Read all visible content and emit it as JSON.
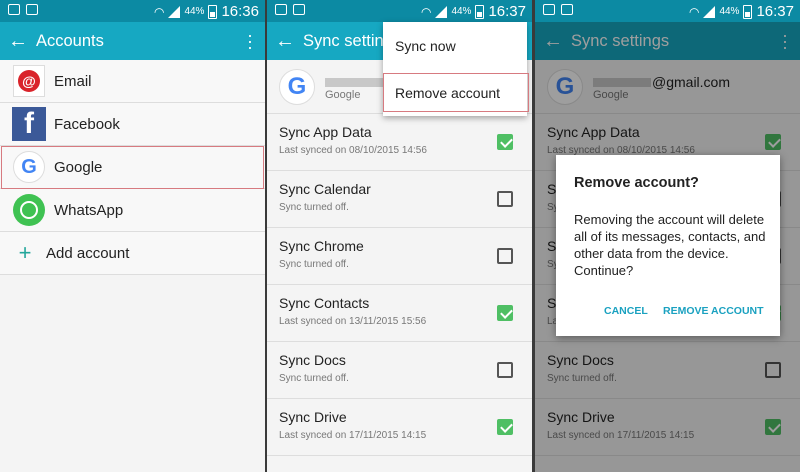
{
  "status": {
    "battery_pct": "44%",
    "time1": "16:36",
    "time2": "16:37",
    "time3": "16:37"
  },
  "accounts": {
    "title": "Accounts",
    "items": [
      {
        "label": "Email",
        "icon": "email-icon"
      },
      {
        "label": "Facebook",
        "icon": "facebook-icon"
      },
      {
        "label": "Google",
        "icon": "google-icon"
      },
      {
        "label": "WhatsApp",
        "icon": "whatsapp-icon"
      }
    ],
    "add_label": "Add account"
  },
  "sync": {
    "title": "Sync settings",
    "title_truncated": "Sync setting",
    "email_suffix": "@gmail.com",
    "email_suffix_short": "@",
    "account_type": "Google",
    "items": [
      {
        "title": "Sync App Data",
        "sub": "Last synced on 08/10/2015 14:56",
        "checked": true
      },
      {
        "title": "Sync Calendar",
        "sub": "Sync turned off.",
        "checked": false
      },
      {
        "title": "Sync Chrome",
        "sub": "Sync turned off.",
        "checked": false
      },
      {
        "title": "Sync Contacts",
        "sub": "Last synced on 13/11/2015 15:56",
        "checked": true
      },
      {
        "title": "Sync Docs",
        "sub": "Sync turned off.",
        "checked": false
      },
      {
        "title": "Sync Drive",
        "sub": "Last synced on 17/11/2015 14:15",
        "checked": true
      }
    ]
  },
  "menu": {
    "sync_now": "Sync now",
    "remove_account": "Remove account"
  },
  "dialog": {
    "title": "Remove account?",
    "body": "Removing the account will delete all of its messages, contacts, and other data from the device. Continue?",
    "cancel": "CANCEL",
    "remove": "REMOVE ACCOUNT"
  },
  "colors": {
    "statusbar": "#0c8aa3",
    "appbar": "#16a8c2",
    "highlight": "#d77a80",
    "check": "#4fbf64",
    "accent": "#1aa1c0"
  }
}
